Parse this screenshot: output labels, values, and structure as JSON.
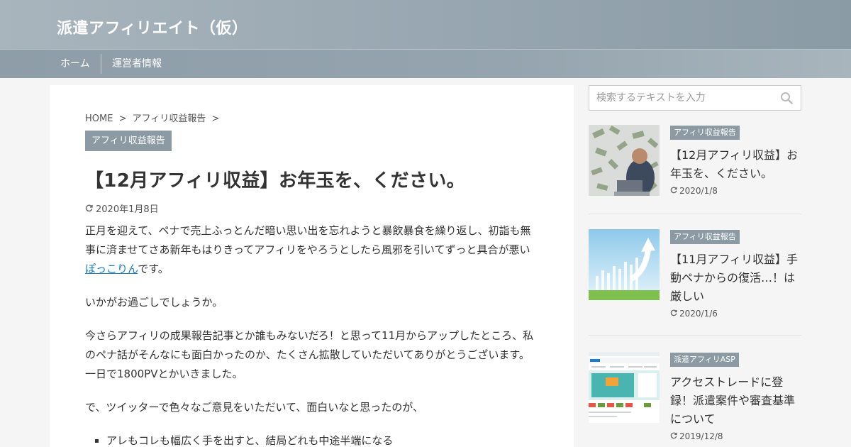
{
  "header": {
    "site_title": "派遣アフィリエイト（仮）"
  },
  "nav": {
    "items": [
      {
        "label": "ホーム"
      },
      {
        "label": "運営者情報"
      }
    ]
  },
  "breadcrumb": {
    "home": "HOME",
    "sep1": ">",
    "category": "アフィリ収益報告",
    "sep2": ">"
  },
  "article": {
    "category": "アフィリ収益報告",
    "title": "【12月アフィリ収益】お年玉を、ください。",
    "date": "2020年1月8日",
    "paragraphs": {
      "p1_before": "正月を迎えて、ペナで売上ふっとんだ暗い思い出を忘れようと暴飲暴食を繰り返し、初詣も無事に済ませてさあ新年もはりきってアフィリをやろうとしたら風邪を引いてずっと具合が悪い",
      "p1_link": "ぽっこりん",
      "p1_after": "です。",
      "p2": "いかがお過ごしでしょうか。",
      "p3": "今さらアフィリの成果報告記事とか誰もみないだろ！と思って11月からアップしたところ、私のペナ話がそんなにも面白かったのか、たくさん拡散していただいてありがとうございます。一日で1800PVとかいきました。",
      "p4": "で、ツイッターで色々なご意見をいただいて、面白いなと思ったのが、",
      "list1": "アレもコレも幅広く手を出すと、結局どれも中途半端になる"
    }
  },
  "sidebar": {
    "search_placeholder": "検索するテキストを入力",
    "posts": [
      {
        "category": "アフィリ収益報告",
        "title": "【12月アフィリ収益】お年玉を、ください。",
        "date": "2020/1/8"
      },
      {
        "category": "アフィリ収益報告",
        "title": "【11月アフィリ収益】手動ペナからの復活…！は厳しい",
        "date": "2020/1/6"
      },
      {
        "category": "派遣アフィリASP",
        "title": "アクセストレードに登録！派遣案件や審査基準について",
        "date": "2019/12/8"
      }
    ]
  },
  "icons": {
    "search": "search-icon",
    "date": "refresh-icon"
  },
  "colors": {
    "accent": "#8b9aa3",
    "link": "#1a7dc4",
    "header": "#9aa8b1"
  }
}
